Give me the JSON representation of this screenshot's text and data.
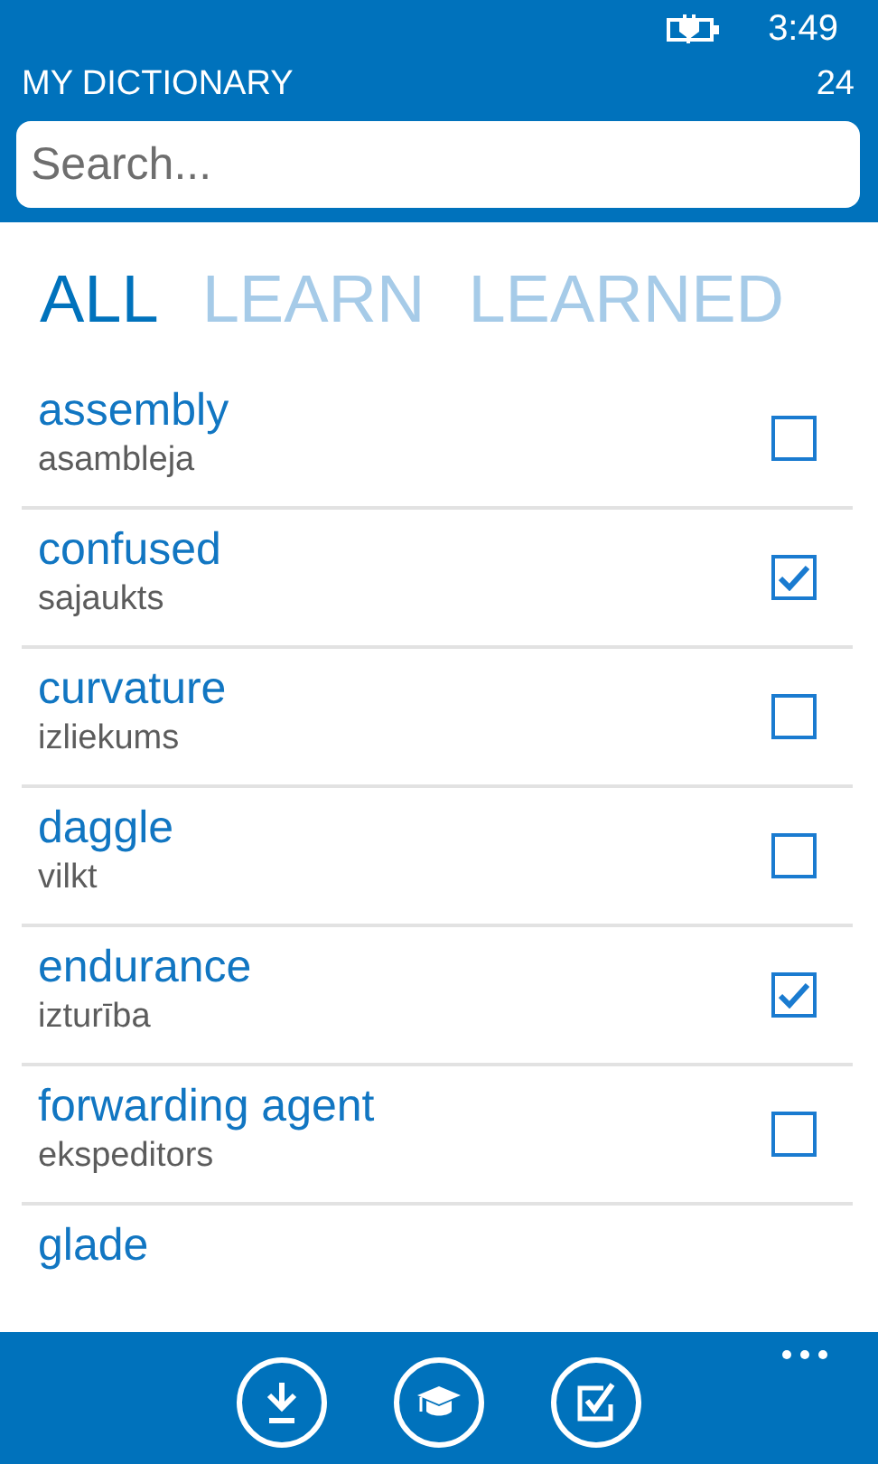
{
  "status_bar": {
    "time": "3:49"
  },
  "header": {
    "title": "MY DICTIONARY",
    "count": "24",
    "search": {
      "placeholder": "Search..."
    }
  },
  "tabs": [
    {
      "label": "ALL",
      "selected": true
    },
    {
      "label": "LEARN",
      "selected": false
    },
    {
      "label": "LEARNED",
      "selected": false
    }
  ],
  "words": [
    {
      "word": "assembly",
      "translation": "asambleja",
      "checked": false
    },
    {
      "word": "confused",
      "translation": "sajaukts",
      "checked": true
    },
    {
      "word": "curvature",
      "translation": "izliekums",
      "checked": false
    },
    {
      "word": "daggle",
      "translation": "vilkt",
      "checked": false
    },
    {
      "word": "endurance",
      "translation": "izturība",
      "checked": true
    },
    {
      "word": "forwarding agent",
      "translation": "ekspeditors",
      "checked": false
    },
    {
      "word": "glade"
    }
  ],
  "app_bar": {
    "buttons": [
      {
        "kind": "download"
      },
      {
        "kind": "learn"
      },
      {
        "kind": "learned"
      }
    ]
  }
}
